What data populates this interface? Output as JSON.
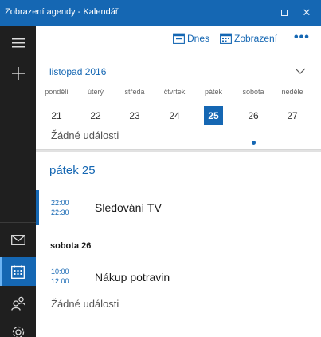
{
  "window": {
    "title": "Zobrazení agendy - Kalendář",
    "controls": {
      "minimize": "–",
      "close": "✕"
    }
  },
  "sidebar": {
    "icons": [
      "hamburger-menu-icon",
      "plus-icon",
      "mail-icon",
      "calendar-icon",
      "people-icon",
      "settings-icon"
    ],
    "selected": "calendar-icon"
  },
  "toolbar": {
    "today_label": "Dnes",
    "view_label": "Zobrazení",
    "more_label": "•••"
  },
  "calendar": {
    "month_label": "listopad 2016",
    "days": [
      {
        "name": "pondělí",
        "num": "21"
      },
      {
        "name": "úterý",
        "num": "22"
      },
      {
        "name": "středa",
        "num": "23"
      },
      {
        "name": "čtvrtek",
        "num": "24"
      },
      {
        "name": "pátek",
        "num": "25"
      },
      {
        "name": "sobota",
        "num": "26"
      },
      {
        "name": "neděle",
        "num": "27"
      }
    ],
    "selected_day": "25",
    "dot_day": "26"
  },
  "agenda": {
    "no_events_top": "Žádné události",
    "friday": {
      "heading": "pátek 25",
      "event": {
        "start": "22:00",
        "end": "22:30",
        "title": "Sledování TV"
      }
    },
    "saturday": {
      "heading": "sobota 26",
      "event": {
        "start": "10:00",
        "end": "12:00",
        "title": "Nákup potravin"
      }
    },
    "no_events_bottom": "Žádné události"
  },
  "colors": {
    "accent": "#1567b3",
    "sidebar": "#1f1f1f"
  }
}
